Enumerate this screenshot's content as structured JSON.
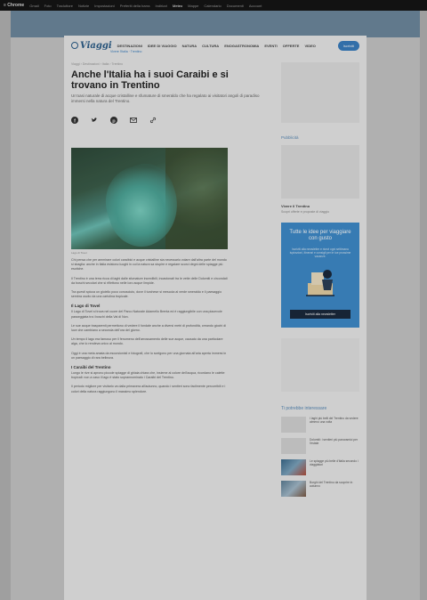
{
  "topbar": {
    "logo": "≡ Chrome",
    "links": [
      "Gmail",
      "Foto",
      "Traduttore",
      "Notizie",
      "Impostazioni",
      "Preferiti della barra",
      "Indirizzi",
      "Meteo",
      "Mappe",
      "Calendario",
      "Documenti",
      "Account"
    ]
  },
  "nav": {
    "brand": "Viaggi",
    "menu": [
      "Destinazioni",
      "Idee di viaggio",
      "Natura",
      "Cultura",
      "Enogastronomia",
      "Eventi",
      "Offerte",
      "Video"
    ],
    "subscribe": "Iscriviti",
    "subnav": "Vivere l'Italia · Trentino"
  },
  "article": {
    "breadcrumb": "Viaggi › Destinazioni › Italia › Trentino",
    "title": "Anche l'Italia ha i suoi Caraibi e si trovano in Trentino",
    "subtitle": "Un'oasi naturale di acque cristalline e sfumature di smeraldo che ha regalato ai visitatori angoli di paradiso immersi nella natura del Trentino.",
    "share_icons": [
      "facebook-icon",
      "twitter-icon",
      "pinterest-icon",
      "mail-icon",
      "link-icon"
    ],
    "image_caption": "Lago di Tovel",
    "paragraphs": [
      "Chi pensa che per ammirare colori caraibici e acque cristalline sia necessario volare dall'altra parte del mondo si sbaglia: anche in Italia esistono luoghi in cui la natura sa stupire e regalare scorci degni delle spiagge più esotiche.",
      "Il Trentino è una terra ricca di laghi dalle sfumature incredibili, incastonati tra le vette delle Dolomiti e circondati da boschi secolari che si riflettono nelle loro acque limpide.",
      "Tra questi spicca un gioiello poco conosciuto, dove il turchese si mescola al verde smeraldo e il paesaggio sembra uscito da una cartolina tropicale."
    ],
    "section1_heading": "Il Lago di Tovel",
    "section1_paragraphs": [
      "Il Lago di Tovel si trova nel cuore del Parco Naturale Adamello Brenta ed è raggiungibile con una piacevole passeggiata tra i boschi della Val di Non.",
      "Le sue acque trasparenti permettono di vedere il fondale anche a diversi metri di profondità, creando giochi di luce che cambiano a seconda dell'ora del giorno.",
      "Un tempo il lago era famoso per il fenomeno dell'arrossamento delle sue acque, causato da una particolare alga, che lo rendeva unico al mondo.",
      "Oggi è una meta amata da escursionisti e fotografi, che lo scelgono per una giornata all'aria aperta immersi in un paesaggio di rara bellezza."
    ],
    "section2_heading": "I Caraibi del Trentino",
    "section2_paragraphs": [
      "Lungo le rive si aprono piccole spiagge di ghiaia chiara che, insieme al colore dell'acqua, ricordano le calette tropicali: non a caso il lago è stato soprannominato i Caraibi del Trentino.",
      "Il periodo migliore per visitarlo va dalla primavera all'autunno, quando i sentieri sono facilmente percorribili e i colori della natura raggiungono il massimo splendore."
    ]
  },
  "sidebar": {
    "rubric": "Pubblicità",
    "ad_title": "Vivere il Trentino",
    "ad_sub": "Scopri offerte e proposte di viaggio",
    "newsletter_title": "Tutte le idee per viaggiare con gusto",
    "newsletter_text": "Iscriviti alla newsletter e ricevi ogni settimana ispirazioni, itinerari e consigli per le tue prossime vacanze.",
    "newsletter_button": "Iscriviti alla newsletter",
    "related_head": "Ti potrebbe interessare",
    "related": [
      "I laghi più belli del Trentino da vedere almeno una volta",
      "Dolomiti: i sentieri più panoramici per l'estate",
      "Le spiagge più belle d'Italia secondo i viaggiatori",
      "Borghi del Trentino da scoprire in autunno"
    ]
  }
}
